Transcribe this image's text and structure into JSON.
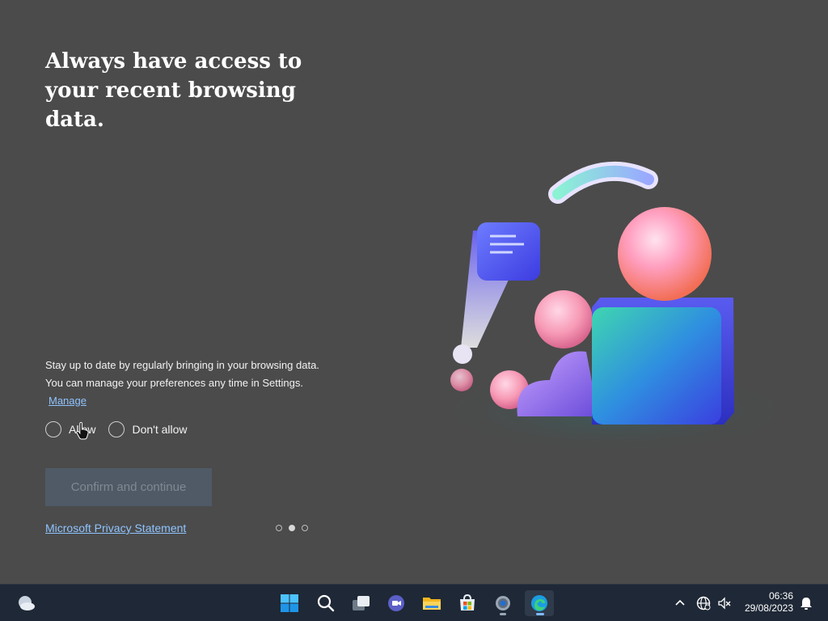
{
  "content": {
    "headline": "Always have access to your recent browsing data.",
    "description": "Stay up to date by regularly bringing in your browsing data. You can manage your preferences any time in Settings.",
    "manage_link": "Manage",
    "options": [
      {
        "label": "Allow",
        "selected": false
      },
      {
        "label": "Don't allow",
        "selected": false
      }
    ],
    "confirm_button": "Confirm and continue",
    "privacy_link": "Microsoft Privacy Statement",
    "pager": {
      "total": 3,
      "current": 2
    }
  },
  "taskbar": {
    "widgets_icon": "weather-icon",
    "apps": [
      {
        "name": "start-icon"
      },
      {
        "name": "search-icon"
      },
      {
        "name": "task-view-icon"
      },
      {
        "name": "teams-chat-icon"
      },
      {
        "name": "file-explorer-icon"
      },
      {
        "name": "microsoft-store-icon"
      },
      {
        "name": "settings-icon"
      },
      {
        "name": "edge-icon",
        "active": true
      }
    ],
    "tray": {
      "time": "06:36",
      "date": "29/08/2023"
    }
  },
  "colors": {
    "background": "#4b4b4b",
    "link": "#8fc4ff",
    "taskbar": "#1f2836",
    "button_disabled": "#4f5a66"
  }
}
